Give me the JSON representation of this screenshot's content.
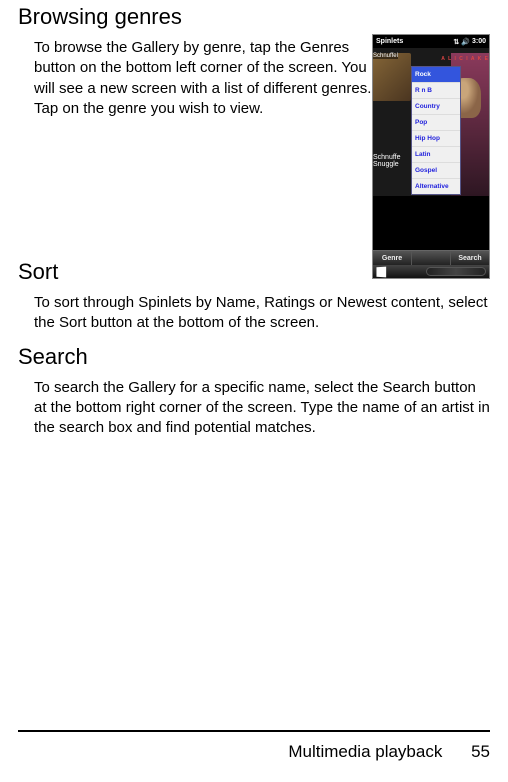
{
  "headings": {
    "browsing_genres": "Browsing genres",
    "sort": "Sort",
    "search": "Search"
  },
  "paragraphs": {
    "browsing_genres": "To browse the Gallery by genre, tap the Genres button on the bottom left corner of the screen. You will see a new screen with a list of different genres. Tap on the genre you wish to view.",
    "sort": "To sort through Spinlets by Name, Ratings or Newest content, select the Sort button at the bottom of the screen.",
    "search": "To search the Gallery for a specific name, select the Search button at the bottom right corner of the screen. Type the name of an artist in the search box and find potential matches."
  },
  "screenshot": {
    "status_bar": {
      "app_name": "Spinlets",
      "time": "3:00"
    },
    "album_left_label": "Schnuffel",
    "album_right_label": "A L I C I A K E",
    "track1": "Schnuffe",
    "track2": "Snuggle",
    "genre_menu": [
      "Rock",
      "R n B",
      "Country",
      "Pop",
      "Hip Hop",
      "Latin",
      "Gospel",
      "Alternative"
    ],
    "selected_genre_index": 0,
    "bottom_buttons": {
      "left": "Genre",
      "right": "Search"
    }
  },
  "footer": {
    "section": "Multimedia playback",
    "page": "55"
  }
}
